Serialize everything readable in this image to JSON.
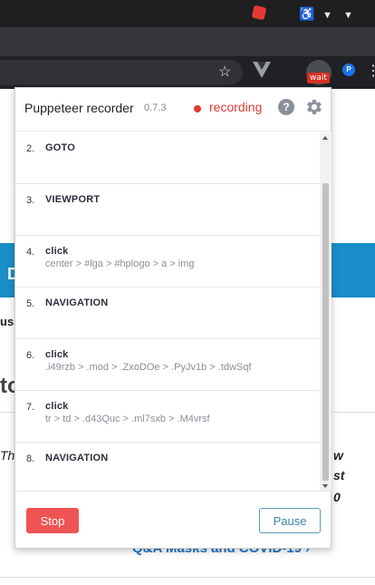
{
  "browser": {
    "badge_text": "wait",
    "ext_letter": "P"
  },
  "background_page": {
    "link_text": "Q&A Masks and COVID-19",
    "fragments": [
      "D",
      "usi",
      "to",
      "Th",
      "w",
      "st",
      "0"
    ]
  },
  "popup": {
    "title": "Puppeteer recorder",
    "version": "0.7.3",
    "status": "recording",
    "help_glyph": "?",
    "steps": [
      {
        "num": "2.",
        "action": "GOTO",
        "selector": ""
      },
      {
        "num": "3.",
        "action": "VIEWPORT",
        "selector": ""
      },
      {
        "num": "4.",
        "action": "click",
        "selector": "center > #lga > #hplogo > a > img"
      },
      {
        "num": "5.",
        "action": "NAVIGATION",
        "selector": ""
      },
      {
        "num": "6.",
        "action": "click",
        "selector": ".i49rzb > .mod > .ZxoDOe > .PyJv1b > .tdwSqf"
      },
      {
        "num": "7.",
        "action": "click",
        "selector": "tr > td > .d43Quc > .ml7sxb > .M4vrsf"
      },
      {
        "num": "8.",
        "action": "NAVIGATION",
        "selector": ""
      }
    ],
    "stop_label": "Stop",
    "pause_label": "Pause"
  },
  "colors": {
    "recording_red": "#e53935",
    "stop_red": "#ef5454",
    "pause_blue": "#3a84a8"
  }
}
